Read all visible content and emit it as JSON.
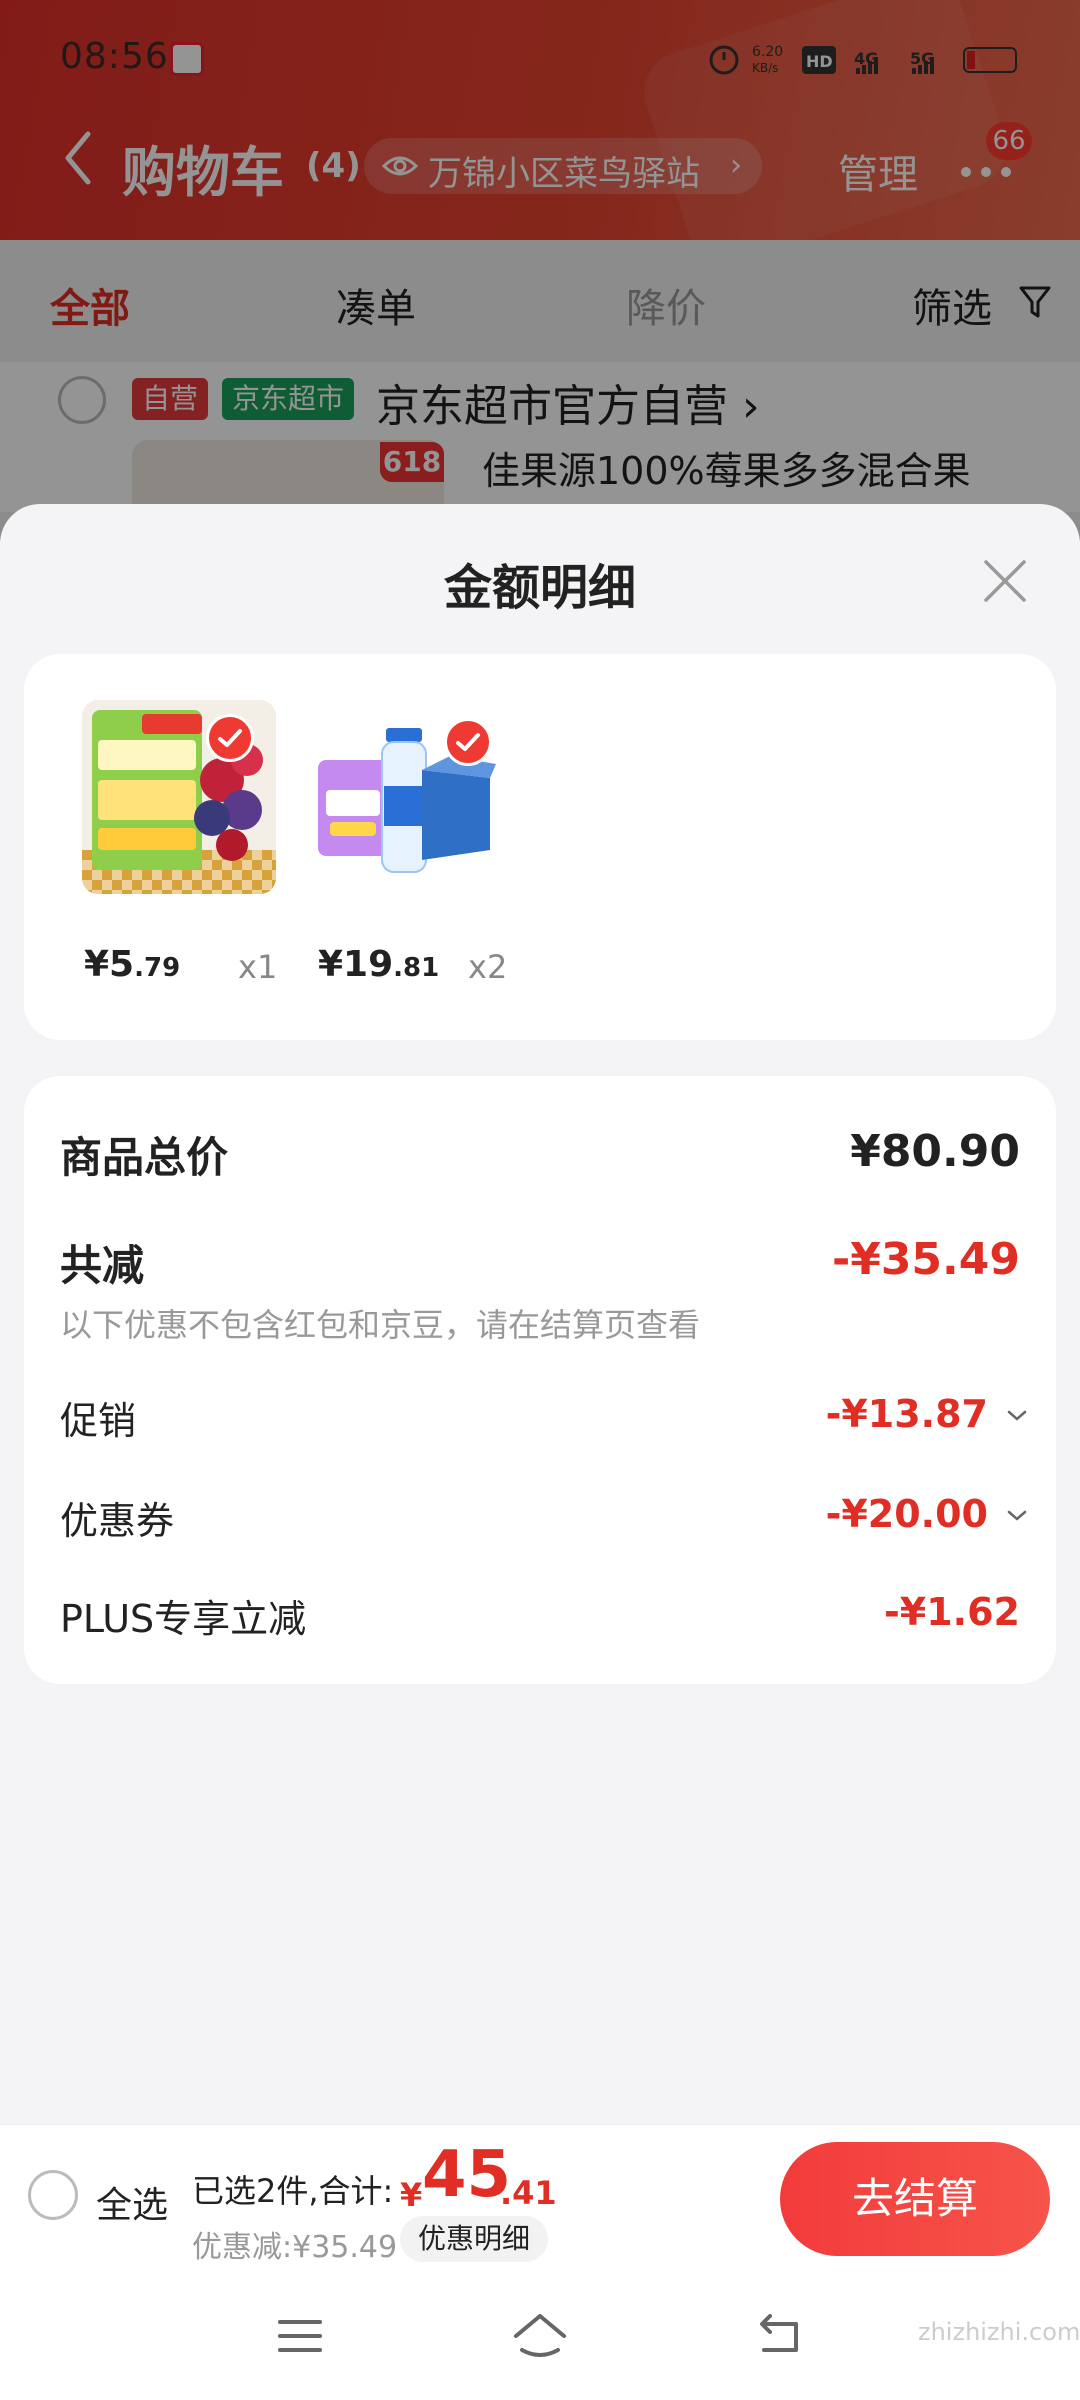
{
  "status_bar": {
    "time": "08:56",
    "net_speed": "6.20 KB/s",
    "signal": "4G 5G"
  },
  "header": {
    "title": "购物车",
    "count": "(4)",
    "location": "万锦小区菜鸟驿站",
    "manage": "管理",
    "message_badge": "66"
  },
  "tabs": [
    {
      "label": "全部",
      "active": true
    },
    {
      "label": "凑单"
    },
    {
      "label": "降价"
    },
    {
      "label": "筛选"
    }
  ],
  "store": {
    "tag_self": "自营",
    "tag_market": "京东超市",
    "name": "京东超市官方自营 ›",
    "badge": "618",
    "product_name": "佳果源100%莓果多多混合果"
  },
  "sheet": {
    "title": "金额明细",
    "items": [
      {
        "price_int": "¥5",
        "price_dec": ".79",
        "qty": "x1"
      },
      {
        "price_int": "¥19",
        "price_dec": ".81",
        "qty": "x2"
      }
    ],
    "summary": {
      "total_label": "商品总价",
      "total_value": "¥80.90",
      "reduce_label": "共减",
      "reduce_value": "-¥35.49",
      "reduce_note": "以下优惠不包含红包和京豆，请在结算页查看",
      "promo_label": "促销",
      "promo_value": "-¥13.87",
      "coupon_label": "优惠券",
      "coupon_value": "-¥20.00",
      "plus_label": "PLUS专享立减",
      "plus_value": "-¥1.62"
    }
  },
  "bottom": {
    "select_all": "全选",
    "selected_text": "已选2件,合计:",
    "total_yen": "¥",
    "total_int": "45",
    "total_dec": ".41",
    "discount_text": "优惠减:¥35.49",
    "detail_chip": "优惠明细",
    "checkout": "去结算"
  },
  "watermark": "zhizhizhi.com",
  "colors": {
    "accent": "#e02e24",
    "header": "#e0302a",
    "checkout": "#f23b3b"
  }
}
